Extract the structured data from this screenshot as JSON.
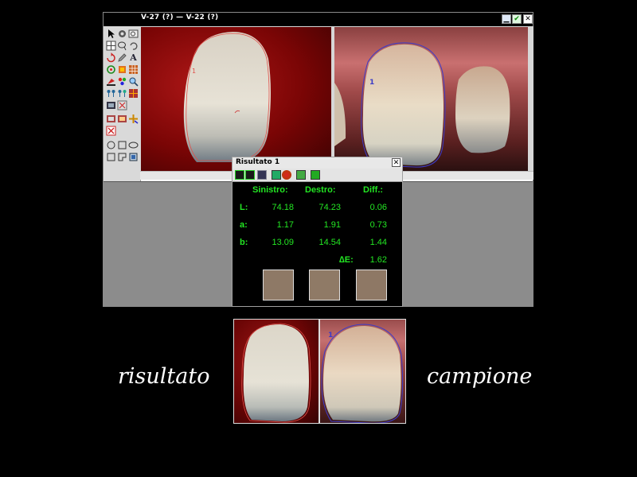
{
  "window": {
    "title": "V-27 (?) — V-22 (?)",
    "min_glyph": "▁",
    "ok_glyph": "✔",
    "close_glyph": "✕"
  },
  "toolbar": {
    "icons": [
      "pointer-icon",
      "gear-icon",
      "zoom-window-icon",
      "grid-icon",
      "lasso-icon",
      "undo-icon",
      "rotate-icon",
      "pencil-icon",
      "text-icon",
      "refresh-icon",
      "color-cube-icon",
      "grid-color-icon",
      "paint-icon",
      "palette-icon",
      "zoom-icon",
      "dots-icon",
      "dots2-icon",
      "mosaic-icon",
      "film-icon",
      "dots3-icon",
      "select-icon",
      "flag-icon",
      "layers-icon",
      "copy-icon",
      "cross-icon",
      "circle-icon",
      "square-icon",
      "ellipse-icon",
      "rect-icon",
      "pie-icon",
      "rect-select-icon"
    ],
    "text_tool_glyph": "A"
  },
  "result": {
    "title": "Risultato 1",
    "close_glyph": "✕",
    "headers": {
      "left": "Sinistro:",
      "right": "Destro:",
      "diff": "Diff.:"
    },
    "rows": [
      {
        "label": "L:",
        "left": "74.18",
        "right": "74.23",
        "diff": "0.06"
      },
      {
        "label": "a:",
        "left": "1.17",
        "right": "1.91",
        "diff": "0.73"
      },
      {
        "label": "b:",
        "left": "13.09",
        "right": "14.54",
        "diff": "1.44"
      }
    ],
    "delta_label": "∆E:",
    "delta_value": "1.62",
    "swatch_colors": [
      "#8e7966",
      "#8f7a66",
      "#8e7865"
    ],
    "text_color": "#23e623"
  },
  "images": {
    "left_marker": "1",
    "right_marker": "1",
    "left_outline_color": "#e0504a",
    "right_outline_color": "#3c3cc8"
  },
  "captions": {
    "left": "risultato",
    "right": "campione"
  }
}
